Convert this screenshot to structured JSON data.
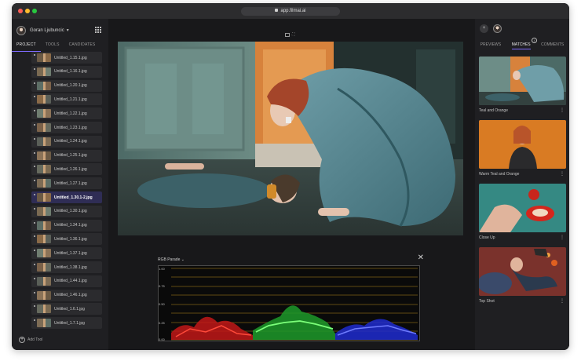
{
  "browser": {
    "url": "app.filmai.ai",
    "dot_colors": [
      "#ff5f57",
      "#febc2e",
      "#28c840"
    ]
  },
  "sidebar": {
    "user_name": "Goran Ljubuncic",
    "tabs": [
      "PROJECT",
      "TOOLS",
      "CANDIDATES"
    ],
    "active_tab": "PROJECT",
    "files": [
      "Untitled_1.15.1.jpg",
      "Untitled_1.16.1.jpg",
      "Untitled_1.20.1.jpg",
      "Untitled_1.21.1.jpg",
      "Untitled_1.22.1.jpg",
      "Untitled_1.23.1.jpg",
      "Untitled_1.24.1.jpg",
      "Untitled_1.25.1.jpg",
      "Untitled_1.26.1.jpg",
      "Untitled_1.27.1.jpg",
      "Untitled_1.30.1-2.jpg",
      "Untitled_1.30.1.jpg",
      "Untitled_1.34.1.jpg",
      "Untitled_1.36.1.jpg",
      "Untitled_1.37.1.jpg",
      "Untitled_1.38.1.jpg",
      "Untitled_1.44.1.jpg",
      "Untitled_1.46.1.jpg",
      "Untitled_1.6.1.jpg",
      "Untitled_1.7.1.jpg"
    ],
    "selected_file": "Untitled_1.30.1-2.jpg",
    "add_tool_label": "Add Tool"
  },
  "scope": {
    "title": "RGB Parade",
    "y_ticks": [
      "1.00",
      "0.75",
      "0.50",
      "0.25",
      "0.00"
    ]
  },
  "right_panel": {
    "tabs": [
      "PREVIEWS",
      "MATCHES",
      "COMMENTS"
    ],
    "active_tab": "MATCHES",
    "matches": [
      {
        "label": "Teal and Orange"
      },
      {
        "label": "Warm Teal and Orange"
      },
      {
        "label": "Close Up"
      },
      {
        "label": "Top Shot"
      }
    ]
  },
  "colors": {
    "accent": "#7e6bff",
    "grid_line": "#b58a1c"
  }
}
